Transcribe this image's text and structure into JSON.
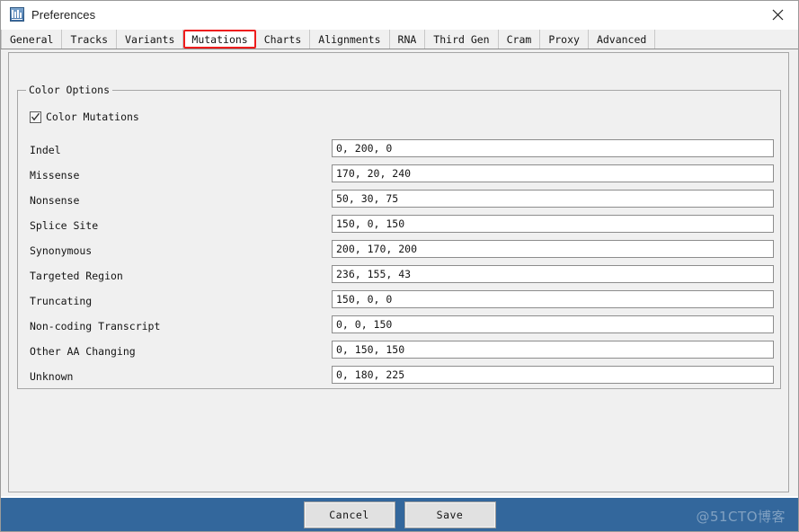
{
  "window": {
    "title": "Preferences",
    "icon": "igv-app-icon",
    "close_label": "✕"
  },
  "tabs": [
    {
      "label": "General",
      "selected": false
    },
    {
      "label": "Tracks",
      "selected": false
    },
    {
      "label": "Variants",
      "selected": false
    },
    {
      "label": "Mutations",
      "selected": true
    },
    {
      "label": "Charts",
      "selected": false
    },
    {
      "label": "Alignments",
      "selected": false
    },
    {
      "label": "RNA",
      "selected": false
    },
    {
      "label": "Third Gen",
      "selected": false
    },
    {
      "label": "Cram",
      "selected": false
    },
    {
      "label": "Proxy",
      "selected": false
    },
    {
      "label": "Advanced",
      "selected": false
    }
  ],
  "group": {
    "title": "Color Options",
    "checkbox": {
      "label": "Color Mutations",
      "checked": true
    },
    "rows": [
      {
        "label": "Indel",
        "value": "0, 200, 0"
      },
      {
        "label": "Missense",
        "value": "170, 20, 240"
      },
      {
        "label": "Nonsense",
        "value": "50, 30, 75"
      },
      {
        "label": "Splice Site",
        "value": "150, 0, 150"
      },
      {
        "label": "Synonymous",
        "value": "200, 170, 200"
      },
      {
        "label": "Targeted Region",
        "value": "236, 155, 43"
      },
      {
        "label": "Truncating",
        "value": "150, 0, 0"
      },
      {
        "label": "Non-coding Transcript",
        "value": "0, 0, 150"
      },
      {
        "label": "Other AA Changing",
        "value": "0, 150, 150"
      },
      {
        "label": "Unknown",
        "value": "0, 180, 225"
      }
    ]
  },
  "footer": {
    "cancel_label": "Cancel",
    "save_label": "Save",
    "watermark": "@51CTO博客",
    "bar_color": "#33679c"
  },
  "colors": {
    "selected_tab_outline": "#ee1c1c",
    "panel_bg": "#f0f0f0",
    "field_bg": "#ffffff",
    "text": "#141414"
  }
}
